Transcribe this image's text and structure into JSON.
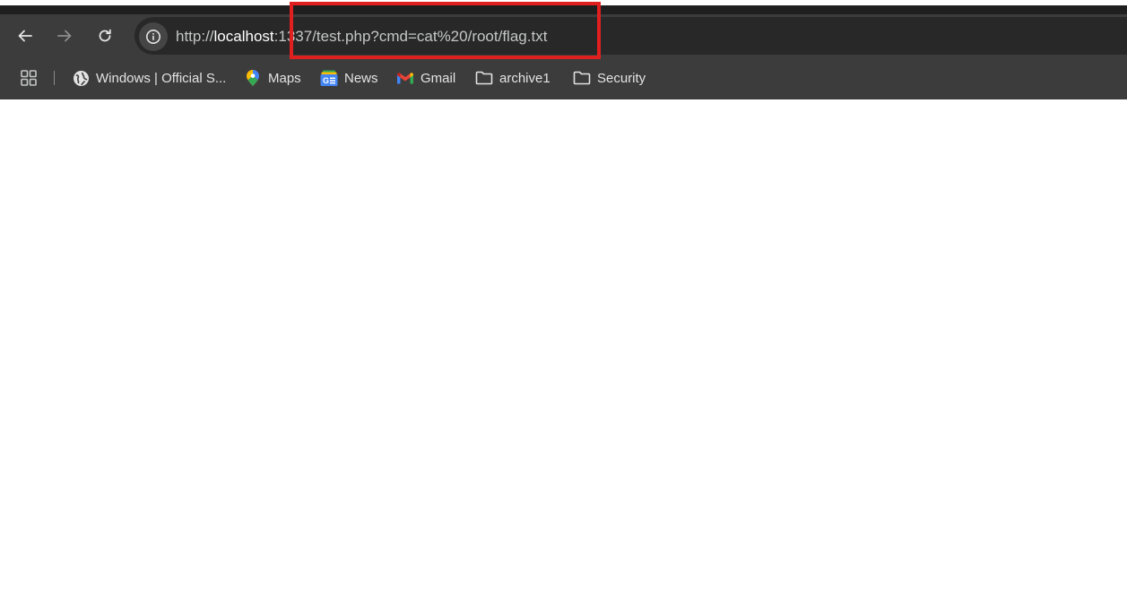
{
  "browser": {
    "url": {
      "scheme": "http://",
      "host": "localhost",
      "rest": ":1337/test.php?cmd=cat%20/root/flag.txt"
    },
    "nav": {
      "back_icon": "arrow-left-icon",
      "forward_icon": "arrow-right-icon",
      "reload_icon": "reload-icon",
      "site_info_icon": "info-icon"
    },
    "annotation_color": "#e01f1f"
  },
  "bookmarks": {
    "apps_icon": "apps-grid-icon",
    "items": [
      {
        "label": "Windows | Official S...",
        "icon": "globe-icon"
      },
      {
        "label": "Maps",
        "icon": "maps-pin-icon"
      },
      {
        "label": "News",
        "icon": "news-icon"
      },
      {
        "label": "Gmail",
        "icon": "gmail-icon"
      },
      {
        "label": "archive1",
        "icon": "folder-icon"
      },
      {
        "label": "Security",
        "icon": "folder-icon"
      }
    ]
  }
}
